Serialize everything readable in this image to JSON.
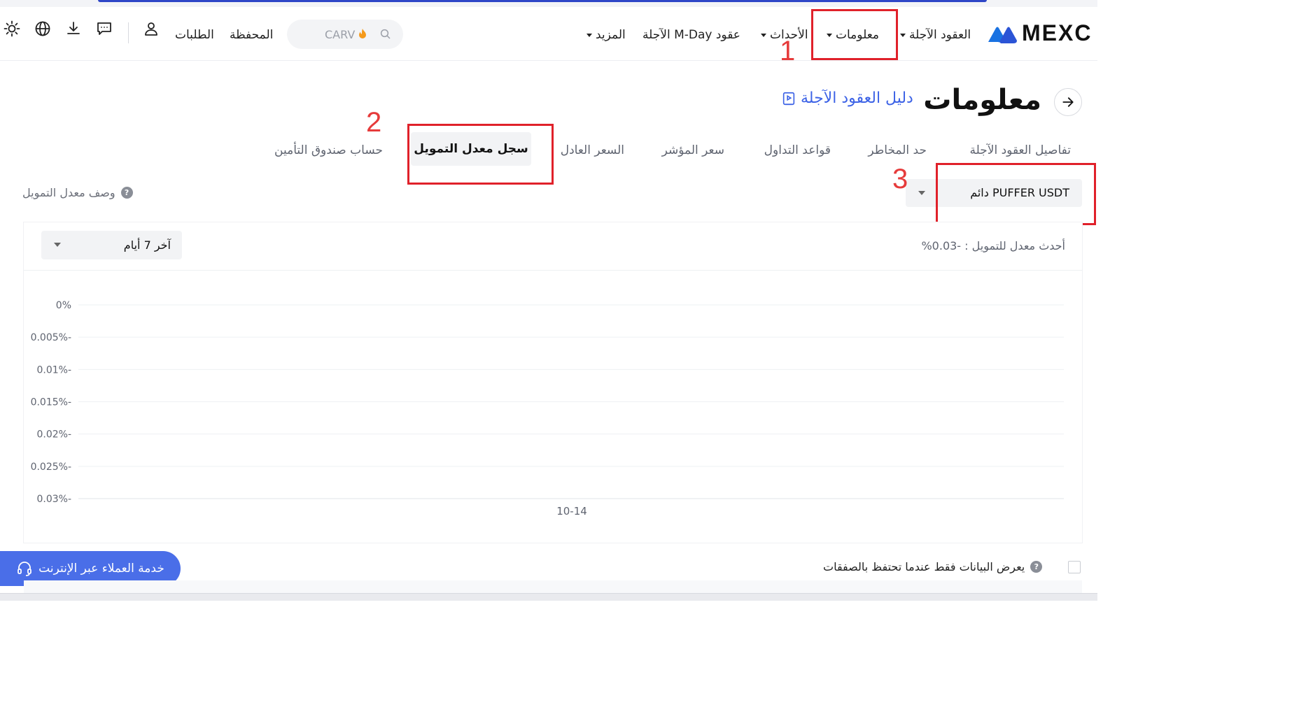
{
  "header": {
    "brand": "MEXC",
    "nav": {
      "futures": "العقود الآجلة",
      "info": "معلومات",
      "events": "الأحداث",
      "mday": "عقود M-Day الآجلة",
      "more": "المزيد"
    },
    "search_text": "CARV",
    "wallet": "المحفظة",
    "orders": "الطلبات",
    "icons": [
      "sun-icon",
      "globe-icon",
      "download-icon",
      "message-icon",
      "user-icon",
      "search-icon",
      "flame-icon"
    ]
  },
  "annotations": {
    "one": "1",
    "two": "2",
    "three": "3",
    "color": "#e0212a"
  },
  "page": {
    "title": "معلومات",
    "guide_link": "دليل العقود الآجلة"
  },
  "tabs": {
    "details": "تفاصيل العقود الآجلة",
    "risk_limit": "حد المخاطر",
    "trading_rules": "قواعد التداول",
    "index_price": "سعر المؤشر",
    "fair_price": "السعر العادل",
    "funding_history": "سجل معدل التمويل",
    "insurance_fund": "حساب صندوق التأمين",
    "active": "funding_history"
  },
  "pair_select": {
    "value": "PUFFER USDT دائم"
  },
  "funding_description": "وصف معدل التمويل",
  "card": {
    "range_value": "آخر 7 أيام",
    "latest_rate": "أحدث معدل للتمويل : -0.03%"
  },
  "chart_data": {
    "type": "line",
    "title": "",
    "xlabel": "",
    "ylabel": "",
    "x": [
      "10-14"
    ],
    "y_ticks": [
      "0%",
      "0.005%-",
      "0.01%-",
      "0.015%-",
      "0.02%-",
      "0.025%-",
      "0.03%-"
    ],
    "ylim": [
      -0.03,
      0
    ],
    "grid": true,
    "series": [
      {
        "values": [
          -0.03
        ]
      }
    ]
  },
  "bottom": {
    "checkbox_label": "يعرض البيانات فقط عندما تحتفظ بالصفقات",
    "customer_service": "خدمة العملاء عبر الإنترنت"
  },
  "colors": {
    "accent": "#3d63e6",
    "button": "#4a6ee8",
    "grid": "#eef0f3"
  }
}
